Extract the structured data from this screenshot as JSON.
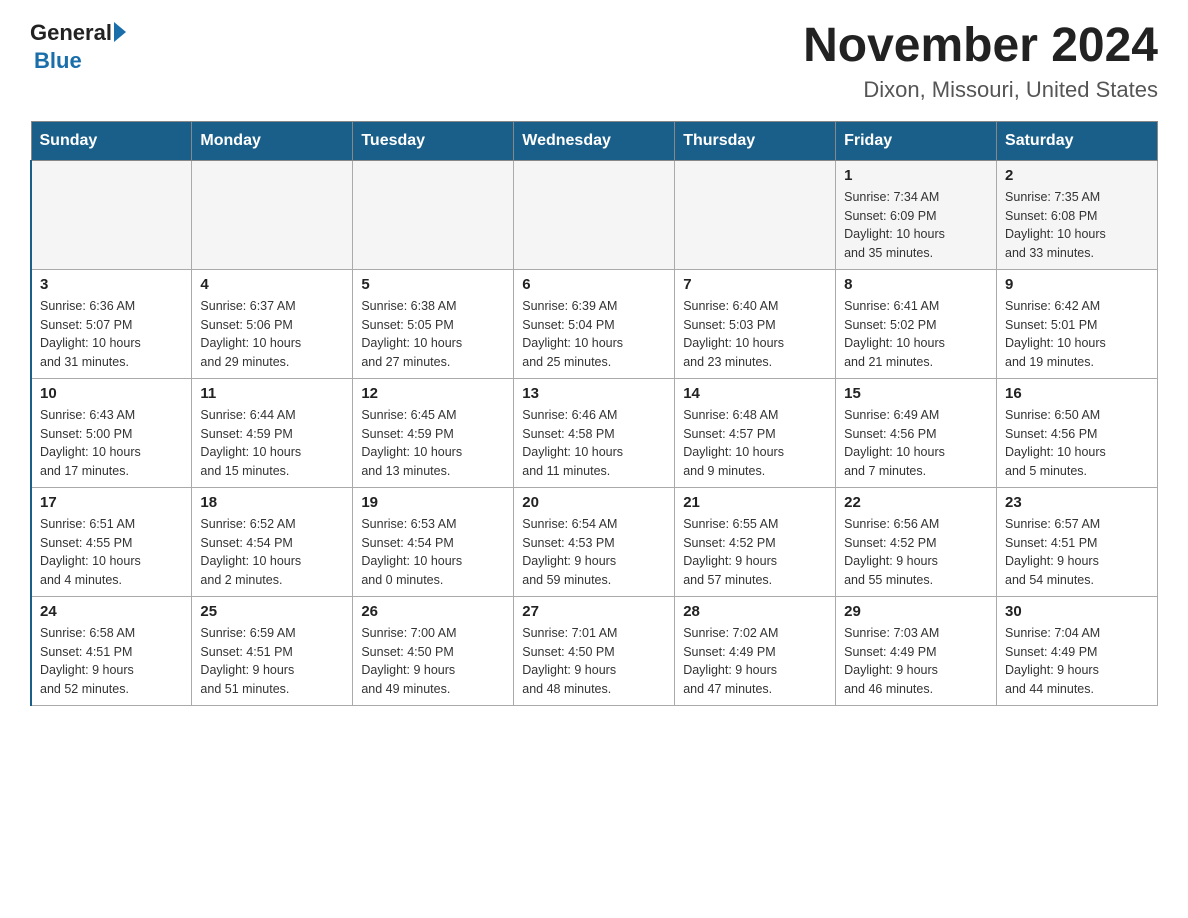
{
  "logo": {
    "general": "General",
    "blue": "Blue"
  },
  "title": "November 2024",
  "subtitle": "Dixon, Missouri, United States",
  "days_header": [
    "Sunday",
    "Monday",
    "Tuesday",
    "Wednesday",
    "Thursday",
    "Friday",
    "Saturday"
  ],
  "weeks": [
    [
      {
        "day": "",
        "info": ""
      },
      {
        "day": "",
        "info": ""
      },
      {
        "day": "",
        "info": ""
      },
      {
        "day": "",
        "info": ""
      },
      {
        "day": "",
        "info": ""
      },
      {
        "day": "1",
        "info": "Sunrise: 7:34 AM\nSunset: 6:09 PM\nDaylight: 10 hours\nand 35 minutes."
      },
      {
        "day": "2",
        "info": "Sunrise: 7:35 AM\nSunset: 6:08 PM\nDaylight: 10 hours\nand 33 minutes."
      }
    ],
    [
      {
        "day": "3",
        "info": "Sunrise: 6:36 AM\nSunset: 5:07 PM\nDaylight: 10 hours\nand 31 minutes."
      },
      {
        "day": "4",
        "info": "Sunrise: 6:37 AM\nSunset: 5:06 PM\nDaylight: 10 hours\nand 29 minutes."
      },
      {
        "day": "5",
        "info": "Sunrise: 6:38 AM\nSunset: 5:05 PM\nDaylight: 10 hours\nand 27 minutes."
      },
      {
        "day": "6",
        "info": "Sunrise: 6:39 AM\nSunset: 5:04 PM\nDaylight: 10 hours\nand 25 minutes."
      },
      {
        "day": "7",
        "info": "Sunrise: 6:40 AM\nSunset: 5:03 PM\nDaylight: 10 hours\nand 23 minutes."
      },
      {
        "day": "8",
        "info": "Sunrise: 6:41 AM\nSunset: 5:02 PM\nDaylight: 10 hours\nand 21 minutes."
      },
      {
        "day": "9",
        "info": "Sunrise: 6:42 AM\nSunset: 5:01 PM\nDaylight: 10 hours\nand 19 minutes."
      }
    ],
    [
      {
        "day": "10",
        "info": "Sunrise: 6:43 AM\nSunset: 5:00 PM\nDaylight: 10 hours\nand 17 minutes."
      },
      {
        "day": "11",
        "info": "Sunrise: 6:44 AM\nSunset: 4:59 PM\nDaylight: 10 hours\nand 15 minutes."
      },
      {
        "day": "12",
        "info": "Sunrise: 6:45 AM\nSunset: 4:59 PM\nDaylight: 10 hours\nand 13 minutes."
      },
      {
        "day": "13",
        "info": "Sunrise: 6:46 AM\nSunset: 4:58 PM\nDaylight: 10 hours\nand 11 minutes."
      },
      {
        "day": "14",
        "info": "Sunrise: 6:48 AM\nSunset: 4:57 PM\nDaylight: 10 hours\nand 9 minutes."
      },
      {
        "day": "15",
        "info": "Sunrise: 6:49 AM\nSunset: 4:56 PM\nDaylight: 10 hours\nand 7 minutes."
      },
      {
        "day": "16",
        "info": "Sunrise: 6:50 AM\nSunset: 4:56 PM\nDaylight: 10 hours\nand 5 minutes."
      }
    ],
    [
      {
        "day": "17",
        "info": "Sunrise: 6:51 AM\nSunset: 4:55 PM\nDaylight: 10 hours\nand 4 minutes."
      },
      {
        "day": "18",
        "info": "Sunrise: 6:52 AM\nSunset: 4:54 PM\nDaylight: 10 hours\nand 2 minutes."
      },
      {
        "day": "19",
        "info": "Sunrise: 6:53 AM\nSunset: 4:54 PM\nDaylight: 10 hours\nand 0 minutes."
      },
      {
        "day": "20",
        "info": "Sunrise: 6:54 AM\nSunset: 4:53 PM\nDaylight: 9 hours\nand 59 minutes."
      },
      {
        "day": "21",
        "info": "Sunrise: 6:55 AM\nSunset: 4:52 PM\nDaylight: 9 hours\nand 57 minutes."
      },
      {
        "day": "22",
        "info": "Sunrise: 6:56 AM\nSunset: 4:52 PM\nDaylight: 9 hours\nand 55 minutes."
      },
      {
        "day": "23",
        "info": "Sunrise: 6:57 AM\nSunset: 4:51 PM\nDaylight: 9 hours\nand 54 minutes."
      }
    ],
    [
      {
        "day": "24",
        "info": "Sunrise: 6:58 AM\nSunset: 4:51 PM\nDaylight: 9 hours\nand 52 minutes."
      },
      {
        "day": "25",
        "info": "Sunrise: 6:59 AM\nSunset: 4:51 PM\nDaylight: 9 hours\nand 51 minutes."
      },
      {
        "day": "26",
        "info": "Sunrise: 7:00 AM\nSunset: 4:50 PM\nDaylight: 9 hours\nand 49 minutes."
      },
      {
        "day": "27",
        "info": "Sunrise: 7:01 AM\nSunset: 4:50 PM\nDaylight: 9 hours\nand 48 minutes."
      },
      {
        "day": "28",
        "info": "Sunrise: 7:02 AM\nSunset: 4:49 PM\nDaylight: 9 hours\nand 47 minutes."
      },
      {
        "day": "29",
        "info": "Sunrise: 7:03 AM\nSunset: 4:49 PM\nDaylight: 9 hours\nand 46 minutes."
      },
      {
        "day": "30",
        "info": "Sunrise: 7:04 AM\nSunset: 4:49 PM\nDaylight: 9 hours\nand 44 minutes."
      }
    ]
  ]
}
